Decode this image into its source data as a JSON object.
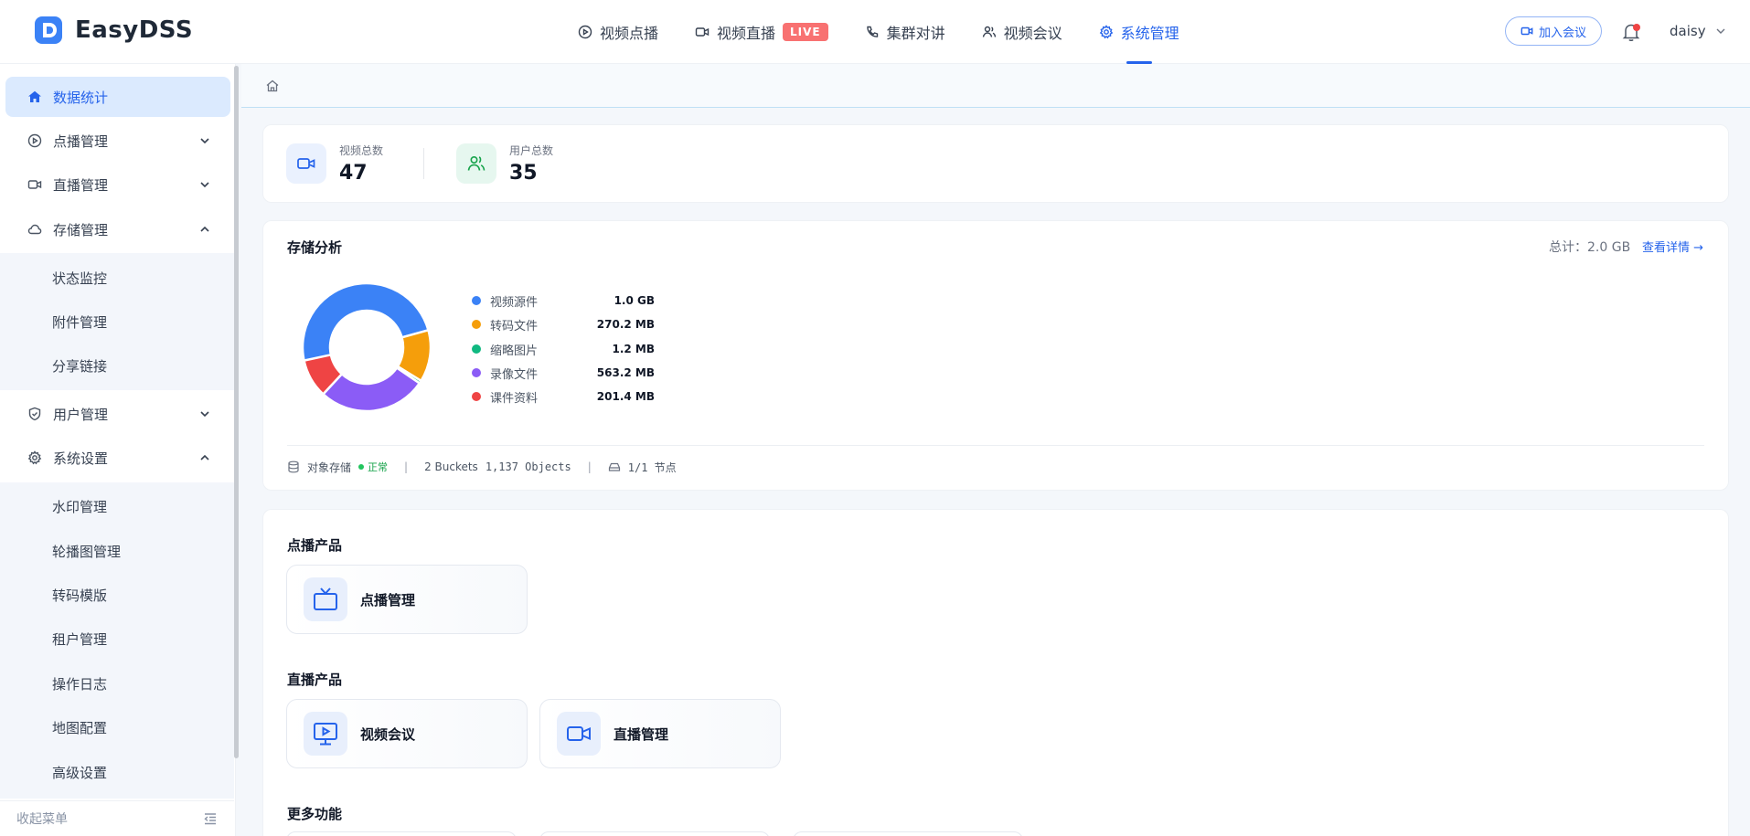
{
  "header": {
    "brand": "EasyDSS",
    "nav": [
      {
        "label": "视频点播",
        "icon": "play-circle-icon"
      },
      {
        "label": "视频直播",
        "icon": "video-camera-icon",
        "badge": "LIVE"
      },
      {
        "label": "集群对讲",
        "icon": "phone-icon"
      },
      {
        "label": "视频会议",
        "icon": "users-icon"
      },
      {
        "label": "系统管理",
        "icon": "gear-icon",
        "active": true
      }
    ],
    "join_button": "加入会议",
    "user": "daisy"
  },
  "sidebar": {
    "items": [
      {
        "label": "数据统计",
        "icon": "home-icon",
        "active": true
      },
      {
        "label": "点播管理",
        "icon": "play-circle-icon",
        "expanded": false
      },
      {
        "label": "直播管理",
        "icon": "video-camera-icon",
        "expanded": false
      },
      {
        "label": "存储管理",
        "icon": "cloud-icon",
        "expanded": true,
        "children": [
          "状态监控",
          "附件管理",
          "分享链接"
        ]
      },
      {
        "label": "用户管理",
        "icon": "shield-icon",
        "expanded": false
      },
      {
        "label": "系统设置",
        "icon": "gear-icon",
        "expanded": true,
        "children": [
          "水印管理",
          "轮播图管理",
          "转码模版",
          "租户管理",
          "操作日志",
          "地图配置",
          "高级设置"
        ]
      }
    ],
    "collapse_label": "收起菜单"
  },
  "stats": [
    {
      "label": "视频总数",
      "value": "47",
      "icon": "video-camera-icon"
    },
    {
      "label": "用户总数",
      "value": "35",
      "icon": "users-icon"
    }
  ],
  "storage": {
    "title": "存储分析",
    "total": "总计：2.0 GB",
    "detail_link": "查看详情 →",
    "status_label": "对象存储",
    "status": "正常",
    "buckets": "2 Buckets",
    "objects": "1,137 Objects",
    "nodes": "1/1 节点",
    "accent": "#2563eb"
  },
  "chart_data": {
    "type": "pie",
    "categories": [
      "视频源件",
      "转码文件",
      "缩略图片",
      "录像文件",
      "课件资料"
    ],
    "value_labels": [
      "1.0 GB",
      "270.2 MB",
      "1.2 MB",
      "563.2 MB",
      "201.4 MB"
    ],
    "values_mb": [
      1024,
      270.2,
      1.2,
      563.2,
      201.4
    ],
    "colors": [
      "#3b82f6",
      "#f59e0b",
      "#10b981",
      "#8b5cf6",
      "#ef4444"
    ]
  },
  "products": {
    "vod_title": "点播产品",
    "vod": [
      {
        "label": "点播管理",
        "icon": "tv-icon"
      }
    ],
    "live_title": "直播产品",
    "live": [
      {
        "label": "视频会议",
        "icon": "monitor-play-icon"
      },
      {
        "label": "直播管理",
        "icon": "video-camera-icon"
      }
    ],
    "more_title": "更多功能"
  }
}
